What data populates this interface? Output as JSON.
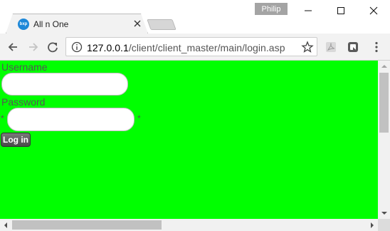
{
  "browser": {
    "profile_name": "Philip",
    "tab": {
      "title": "All n One",
      "favicon_text": "bxp"
    },
    "address": {
      "host": "127.0.0.1",
      "path": "/client/client_master/main/login.asp"
    },
    "icons": {
      "back": "arrow-left-icon",
      "forward": "arrow-right-icon",
      "reload": "reload-icon",
      "info": "info-icon",
      "bookmark": "star-icon",
      "pdf_extension": "pdf-icon",
      "extension": "extension-icon",
      "menu": "kebab-menu-icon"
    }
  },
  "page": {
    "background_color": "#00ff00",
    "username_label": "Username",
    "password_label": "Password",
    "required_marker_left": "*",
    "required_marker_right": "*",
    "login_button": "Log in"
  }
}
